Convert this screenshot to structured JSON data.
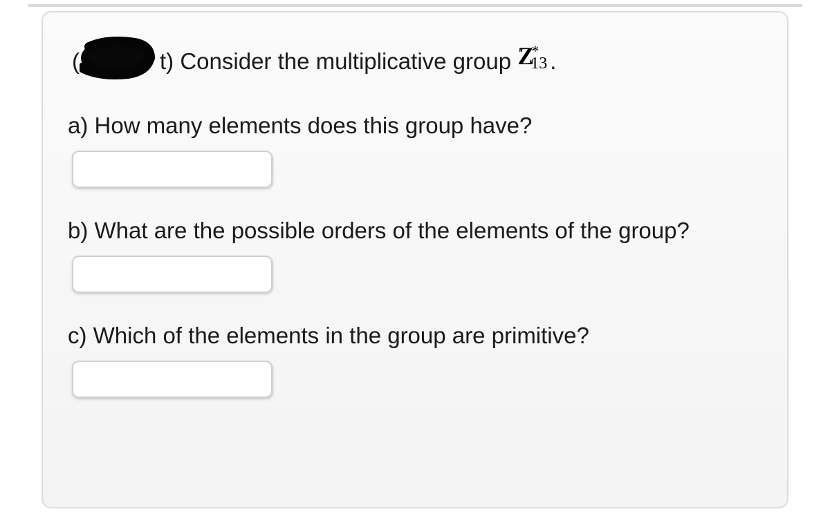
{
  "intro": {
    "paren_left": "(",
    "redacted_visible_tail": "t)",
    "lead": " Consider the multiplicative group ",
    "math_Z": "Z",
    "math_star": "*",
    "math_sub": "13",
    "period": "."
  },
  "parts": {
    "a": {
      "label": "a) How many elements does this group have?",
      "value": ""
    },
    "b": {
      "label": "b) What are the possible orders of the elements of the group?",
      "value": ""
    },
    "c": {
      "label": "c) Which of the elements in the group are primitive?",
      "value": ""
    }
  }
}
